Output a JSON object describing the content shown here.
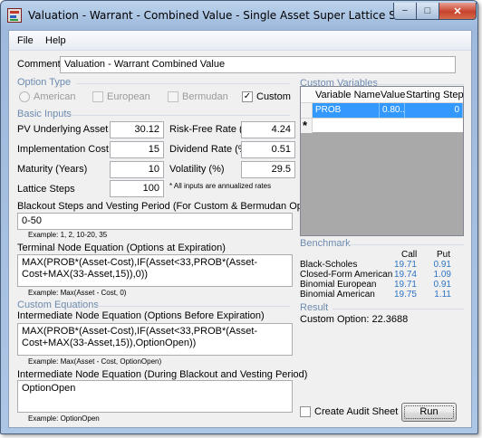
{
  "window": {
    "title": "Valuation - Warrant - Combined Value - Single Asset Super Lattice Solver",
    "controls": {
      "minimize": "−",
      "maximize": "□",
      "close": "✕"
    }
  },
  "menu": [
    "File",
    "Help"
  ],
  "comment": {
    "label": "Comment",
    "value": "Valuation - Warrant Combined Value"
  },
  "option_type": {
    "header": "Option Type",
    "american": "American",
    "european": "European",
    "bermudan": "Bermudan",
    "custom": "Custom",
    "custom_checked": true
  },
  "basic_inputs": {
    "header": "Basic Inputs",
    "pv_underlying": {
      "label": "PV Underlying Asset ($)",
      "value": "30.12"
    },
    "risk_free": {
      "label": "Risk-Free Rate (%)",
      "value": "4.24"
    },
    "impl_cost": {
      "label": "Implementation Cost ($)",
      "value": "15"
    },
    "dividend": {
      "label": "Dividend Rate (%)",
      "value": "0.51"
    },
    "maturity": {
      "label": "Maturity (Years)",
      "value": "10"
    },
    "volatility": {
      "label": "Volatility (%)",
      "value": "29.5"
    },
    "lattice_steps": {
      "label": "Lattice Steps",
      "value": "100"
    },
    "note": "* All inputs are annualized rates"
  },
  "blackout": {
    "label": "Blackout Steps and Vesting Period (For Custom & Bermudan Option)",
    "value": "0-50",
    "example": "Example: 1, 2, 10-20, 35"
  },
  "terminal": {
    "label": "Terminal Node Equation (Options at Expiration)",
    "value": "MAX(PROB*(Asset-Cost),IF(Asset<33,PROB*(Asset-Cost+MAX(33-Asset,15)),0))",
    "example": "Example: Max(Asset - Cost, 0)"
  },
  "custom_equations": {
    "header": "Custom Equations"
  },
  "intermediate": {
    "label": "Intermediate Node Equation (Options Before Expiration)",
    "value": "MAX(PROB*(Asset-Cost),IF(Asset<33,PROB*(Asset-Cost+MAX(33-Asset,15)),OptionOpen))",
    "example": "Example: Max(Asset - Cost, OptionOpen)"
  },
  "intermediate_blackout": {
    "label": "Intermediate Node Equation (During Blackout and Vesting Period)",
    "value": "OptionOpen",
    "example": "Example: OptionOpen"
  },
  "custom_variables": {
    "header": "Custom Variables",
    "columns": [
      "Variable Name",
      "Value",
      "Starting Step"
    ],
    "rows": [
      {
        "name": "PROB",
        "value": "0.80...",
        "step": "0"
      }
    ],
    "new_row_marker": "*"
  },
  "benchmark": {
    "header": "Benchmark",
    "call_label": "Call",
    "put_label": "Put",
    "rows": [
      {
        "name": "Black-Scholes",
        "call": "19.71",
        "put": "0.91"
      },
      {
        "name": "Closed-Form American",
        "call": "19.74",
        "put": "1.09"
      },
      {
        "name": "Binomial European",
        "call": "19.71",
        "put": "0.91"
      },
      {
        "name": "Binomial American",
        "call": "19.75",
        "put": "1.11"
      }
    ]
  },
  "result": {
    "header": "Result",
    "text": "Custom Option: 22.3688"
  },
  "audit": {
    "label": "Create Audit Sheet",
    "checked": false
  },
  "run": {
    "label": "Run"
  }
}
